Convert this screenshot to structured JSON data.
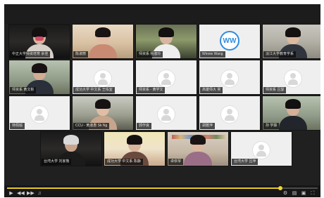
{
  "top_caption": "",
  "participants": [
    {
      "name": "中正大学师资培育 余佳",
      "kind": "camera"
    },
    {
      "name": "陈淑丽",
      "kind": "camera"
    },
    {
      "name": "师资系 杨淑玲",
      "kind": "camera"
    },
    {
      "name": "Winnie Wang",
      "kind": "initials",
      "initials": "WW"
    },
    {
      "name": "淡江大学教育学系",
      "kind": "camera"
    },
    {
      "name": "师资系 黄文彬",
      "kind": "camera"
    },
    {
      "name": "成功大学 中文系 王佑宜",
      "kind": "placeholder"
    },
    {
      "name": "师资系 - 黄学文",
      "kind": "placeholder"
    },
    {
      "name": "高雄师大 吴",
      "kind": "placeholder"
    },
    {
      "name": "师资系 吕瑟",
      "kind": "placeholder"
    },
    {
      "name": "林佩瑜",
      "kind": "placeholder"
    },
    {
      "name": "CCU - 黄淑惠 Sk Ng",
      "kind": "camera"
    },
    {
      "name": "郭作良",
      "kind": "placeholder"
    },
    {
      "name": "胡雅萍",
      "kind": "placeholder"
    },
    {
      "name": "孙 学霖",
      "kind": "camera"
    },
    {
      "name": "台湾大学 刘家熊",
      "kind": "camera"
    },
    {
      "name": "成功大学 中文系 陈静",
      "kind": "camera"
    },
    {
      "name": "卓依琴",
      "kind": "camera"
    },
    {
      "name": "台湾大学 吕萍",
      "kind": "placeholder"
    }
  ],
  "colors": {
    "window_bg": "#202020",
    "progress_accent": "#e6c823",
    "initials_ring": "#2f8de0"
  },
  "controls": {
    "progress": 0.88,
    "buttons": [
      "play-icon",
      "rewind-icon",
      "forward-icon",
      "volume-icon",
      "fullscreen-icon"
    ]
  }
}
